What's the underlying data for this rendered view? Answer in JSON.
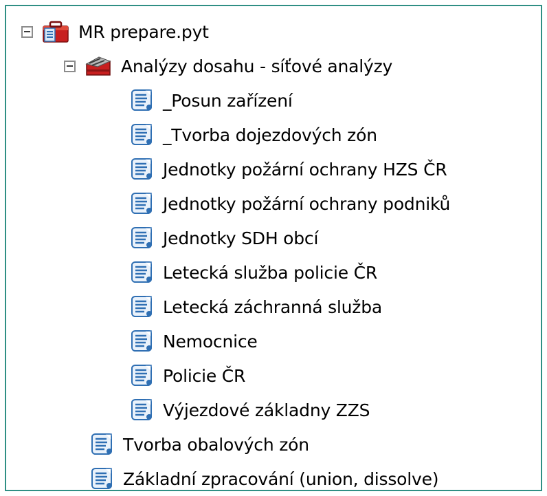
{
  "tree": {
    "root": {
      "label": "MR prepare.pyt",
      "icon": "python-toolbox-icon",
      "expanded": true
    },
    "toolset": {
      "label": "Analýzy dosahu - síťové analýzy",
      "icon": "toolset-icon",
      "expanded": true
    },
    "toolset_scripts": [
      "_Posun zařízení",
      "_Tvorba dojezdových zón",
      "Jednotky požární ochrany HZS ČR",
      "Jednotky požární ochrany podniků",
      "Jednotky SDH obcí",
      "Letecká služba policie ČR",
      "Letecká záchranná služba",
      "Nemocnice",
      "Policie ČR",
      "Výjezdové základny ZZS"
    ],
    "root_scripts": [
      "Tvorba obalových zón",
      "Základní zpracování (union, dissolve)"
    ]
  },
  "colors": {
    "panel_border": "#2f8f84",
    "toolbox_red": "#c81f1f",
    "script_blue": "#2f6fb3"
  }
}
